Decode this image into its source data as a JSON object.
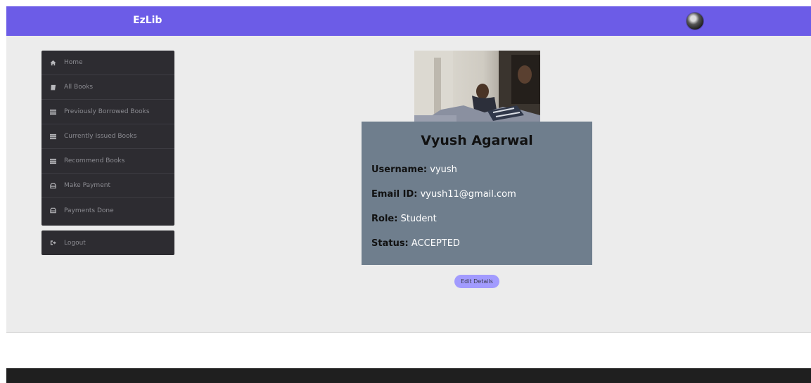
{
  "app": {
    "brand": "EzLib"
  },
  "sidebar": {
    "items": [
      {
        "label": "Home",
        "icon": "home-icon"
      },
      {
        "label": "All Books",
        "icon": "book-icon"
      },
      {
        "label": "Previously Borrowed Books",
        "icon": "list-icon"
      },
      {
        "label": "Currently Issued Books",
        "icon": "list-icon"
      },
      {
        "label": "Recommend Books",
        "icon": "list-icon"
      },
      {
        "label": "Make Payment",
        "icon": "payment-icon"
      },
      {
        "label": "Payments Done",
        "icon": "payment-icon"
      }
    ],
    "logout": {
      "label": "Logout",
      "icon": "logout-icon"
    }
  },
  "profile": {
    "name": "Vyush Agarwal",
    "username_label": "Username:",
    "username": "vyush",
    "email_label": "Email ID:",
    "email": "vyush11@gmail.com",
    "role_label": "Role:",
    "role": "Student",
    "status_label": "Status:",
    "status": "ACCEPTED"
  },
  "actions": {
    "edit_label": "Edit Details"
  },
  "colors": {
    "accent": "#6c5ce7",
    "button": "#a29bfe",
    "sidebar": "#2d2c31",
    "card": "#6f7e8d",
    "footer": "#1f1f1f"
  }
}
